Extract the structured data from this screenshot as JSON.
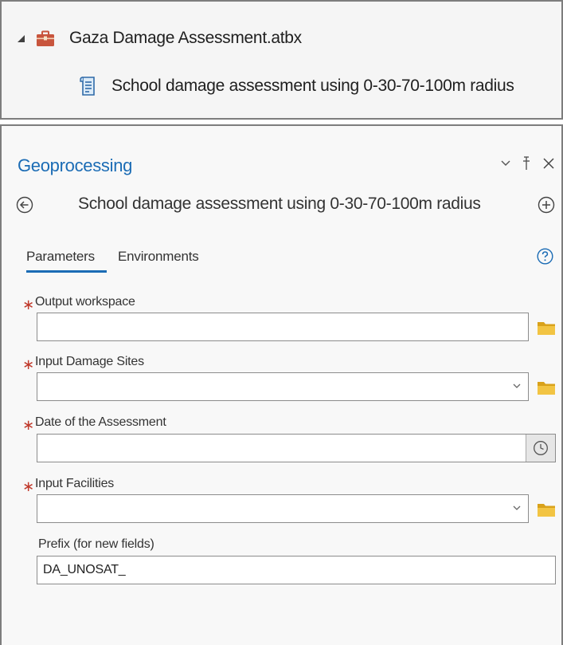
{
  "catalog": {
    "toolbox_name": "Gaza Damage Assessment.atbx",
    "tool_name": "School damage assessment using 0-30-70-100m radius",
    "toolbox_icon": "toolbox-icon",
    "tool_icon": "script-tool-icon"
  },
  "geoprocessing": {
    "pane_title": "Geoprocessing",
    "window_controls": {
      "options": "⌄",
      "pin": "ᵻ",
      "close": "✕"
    },
    "tool_title": "School damage assessment using 0-30-70-100m radius",
    "tabs": [
      {
        "label": "Parameters",
        "active": true
      },
      {
        "label": "Environments",
        "active": false
      }
    ],
    "params": [
      {
        "label": "Output workspace",
        "required": true,
        "required_mark": "∗",
        "value": "",
        "control": "folder"
      },
      {
        "label": "Input Damage Sites",
        "required": true,
        "required_mark": "∗",
        "value": "",
        "control": "dropdown-folder"
      },
      {
        "label": "Date of the Assessment",
        "required": true,
        "required_mark": "∗",
        "value": "",
        "control": "date"
      },
      {
        "label": "Input Facilities",
        "required": true,
        "required_mark": "∗",
        "value": "",
        "control": "dropdown-folder"
      },
      {
        "label": "Prefix (for new fields)",
        "required": false,
        "required_mark": "",
        "value": "DA_UNOSAT_",
        "control": "text"
      }
    ]
  },
  "colors": {
    "accent": "#1b6cb5",
    "required": "#c0392b",
    "folder": "#e8b923"
  }
}
